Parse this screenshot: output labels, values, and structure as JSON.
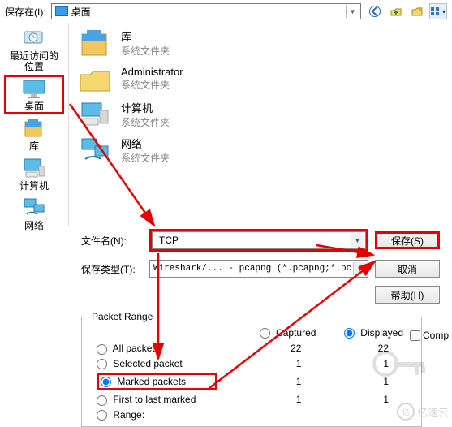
{
  "top": {
    "save_in_label": "保存在(I):",
    "location_text": "桌面"
  },
  "sidebar": {
    "places": [
      {
        "label": "最近访问的位置"
      },
      {
        "label": "桌面"
      },
      {
        "label": "库"
      },
      {
        "label": "计算机"
      },
      {
        "label": "网络"
      }
    ]
  },
  "folders": [
    {
      "title": "库",
      "subtitle": "系统文件夹"
    },
    {
      "title": "Administrator",
      "subtitle": "系统文件夹"
    },
    {
      "title": "计算机",
      "subtitle": "系统文件夹"
    },
    {
      "title": "网络",
      "subtitle": "系统文件夹"
    }
  ],
  "file": {
    "name_label": "文件名(N):",
    "name_value": "TCP",
    "type_label": "保存类型(T):",
    "type_value": "Wireshark/... - pcapng (*.pcapng;*.pc"
  },
  "buttons": {
    "save": "保存(S)",
    "cancel": "取消",
    "help": "帮助(H)"
  },
  "range": {
    "legend": "Packet Range",
    "captured_label": "Captured",
    "displayed_label": "Displayed",
    "rows": [
      {
        "label": "All packets",
        "captured": "22",
        "displayed": "22"
      },
      {
        "label": "Selected packet",
        "captured": "1",
        "displayed": "1"
      },
      {
        "label": "Marked packets",
        "captured": "1",
        "displayed": "1"
      },
      {
        "label": "First to last marked",
        "captured": "1",
        "displayed": "1"
      }
    ],
    "range_row_label": "Range:"
  },
  "comp_label": "Comp"
}
